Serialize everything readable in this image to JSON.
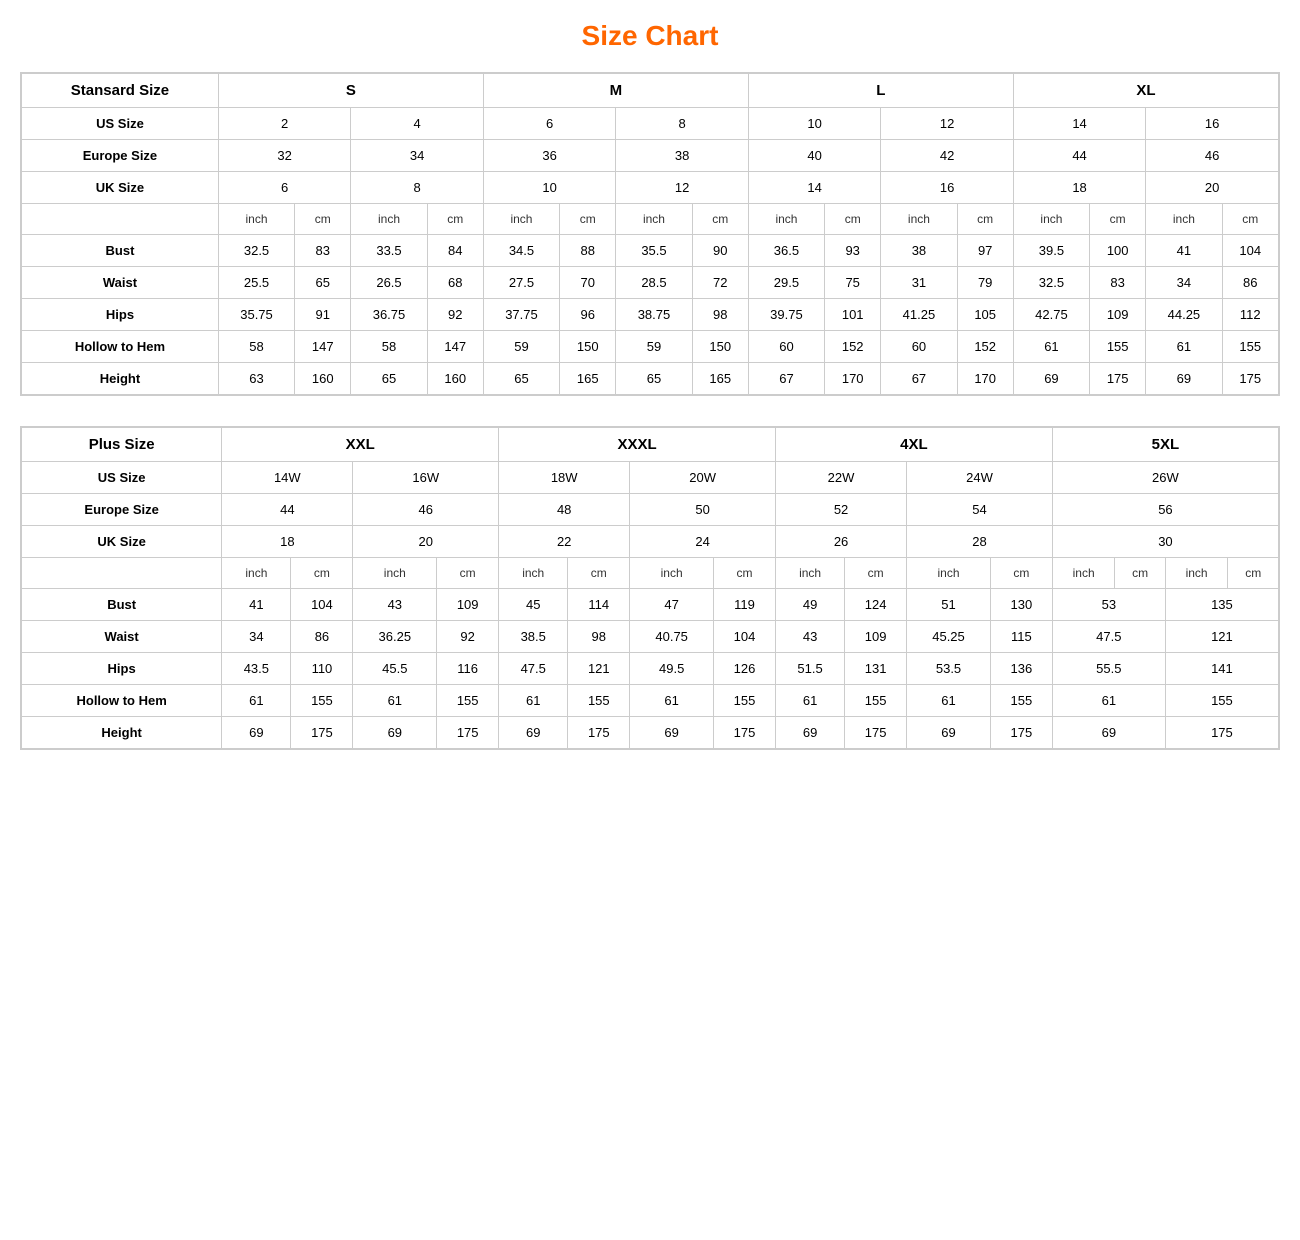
{
  "title": "Size Chart",
  "table1": {
    "caption": "Standard Size",
    "sizeGroups": [
      "S",
      "M",
      "L",
      "XL"
    ],
    "usSizes": [
      "2",
      "4",
      "6",
      "8",
      "10",
      "12",
      "14",
      "16"
    ],
    "europeSizes": [
      "32",
      "34",
      "36",
      "38",
      "40",
      "42",
      "44",
      "46"
    ],
    "ukSizes": [
      "6",
      "8",
      "10",
      "12",
      "14",
      "16",
      "18",
      "20"
    ],
    "measurements": {
      "bust": [
        "32.5",
        "83",
        "33.5",
        "84",
        "34.5",
        "88",
        "35.5",
        "90",
        "36.5",
        "93",
        "38",
        "97",
        "39.5",
        "100",
        "41",
        "104"
      ],
      "waist": [
        "25.5",
        "65",
        "26.5",
        "68",
        "27.5",
        "70",
        "28.5",
        "72",
        "29.5",
        "75",
        "31",
        "79",
        "32.5",
        "83",
        "34",
        "86"
      ],
      "hips": [
        "35.75",
        "91",
        "36.75",
        "92",
        "37.75",
        "96",
        "38.75",
        "98",
        "39.75",
        "101",
        "41.25",
        "105",
        "42.75",
        "109",
        "44.25",
        "112"
      ],
      "hollowToHem": [
        "58",
        "147",
        "58",
        "147",
        "59",
        "150",
        "59",
        "150",
        "60",
        "152",
        "60",
        "152",
        "61",
        "155",
        "61",
        "155"
      ],
      "height": [
        "63",
        "160",
        "65",
        "160",
        "65",
        "165",
        "65",
        "165",
        "67",
        "170",
        "67",
        "170",
        "69",
        "175",
        "69",
        "175"
      ]
    }
  },
  "table2": {
    "caption": "Plus Size",
    "sizeGroups": [
      "XXL",
      "XXXL",
      "4XL",
      "5XL"
    ],
    "usSizes": [
      "14W",
      "16W",
      "18W",
      "20W",
      "22W",
      "24W",
      "26W"
    ],
    "europeSizes": [
      "44",
      "46",
      "48",
      "50",
      "52",
      "54",
      "56"
    ],
    "ukSizes": [
      "18",
      "20",
      "22",
      "24",
      "26",
      "28",
      "30"
    ],
    "measurements": {
      "bust": [
        "41",
        "104",
        "43",
        "109",
        "45",
        "114",
        "47",
        "119",
        "49",
        "124",
        "51",
        "130",
        "53",
        "135"
      ],
      "waist": [
        "34",
        "86",
        "36.25",
        "92",
        "38.5",
        "98",
        "40.75",
        "104",
        "43",
        "109",
        "45.25",
        "115",
        "47.5",
        "121"
      ],
      "hips": [
        "43.5",
        "110",
        "45.5",
        "116",
        "47.5",
        "121",
        "49.5",
        "126",
        "51.5",
        "131",
        "53.5",
        "136",
        "55.5",
        "141"
      ],
      "hollowToHem": [
        "61",
        "155",
        "61",
        "155",
        "61",
        "155",
        "61",
        "155",
        "61",
        "155",
        "61",
        "155",
        "61",
        "155"
      ],
      "height": [
        "69",
        "175",
        "69",
        "175",
        "69",
        "175",
        "69",
        "175",
        "69",
        "175",
        "69",
        "175",
        "69",
        "175"
      ]
    }
  },
  "labels": {
    "stansardSize": "Stansard Size",
    "plusSize": "Plus Size",
    "usSize": "US Size",
    "europeSize": "Europe Size",
    "ukSize": "UK Size",
    "bust": "Bust",
    "waist": "Waist",
    "hips": "Hips",
    "hollowToHem": "Hollow to Hem",
    "height": "Height",
    "inch": "inch",
    "cm": "cm"
  }
}
